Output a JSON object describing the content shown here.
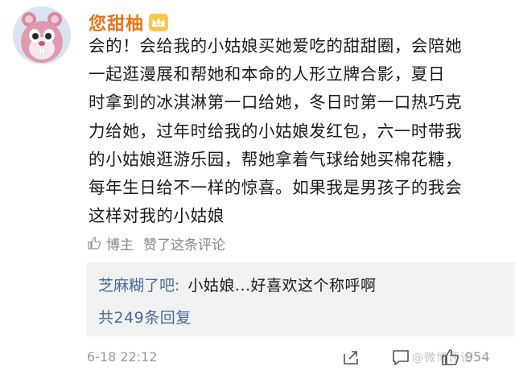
{
  "comment": {
    "username": "您甜柚",
    "avatar_icon": "cartoon-squirrel-avatar-icon",
    "badge_icon": "vip-crown-icon",
    "text": "会的！会给我的小姑娘买她爱吃的甜甜圈，会陪她\n一起逛漫展和帮她和本命的人形立牌合影，夏日\n时拿到的冰淇淋第一口给她，冬日时第一口热巧克\n力给她，过年时给我的小姑娘发红包，六一时带我\n的小姑娘逛游乐园，帮她拿着气球给她买棉花糖，\n每年生日给不一样的惊喜。如果我是男孩子的我会\n这样对我的小姑娘",
    "liked_by": "博主",
    "liked_text": "赞了这条评论",
    "like_icon": "thumbs-up-icon"
  },
  "reply": {
    "author": "芝麻糊了吧:",
    "text": "小姑娘...好喜欢这个称呼啊",
    "count_text": "共249条回复"
  },
  "footer": {
    "timestamp": "6-18  22:12",
    "like_count": "954",
    "watermark": "@微博评论"
  },
  "colors": {
    "username": "#e8741a",
    "link": "#4a6a9a",
    "reply_bg": "#f2f2f2",
    "muted": "#999999"
  }
}
